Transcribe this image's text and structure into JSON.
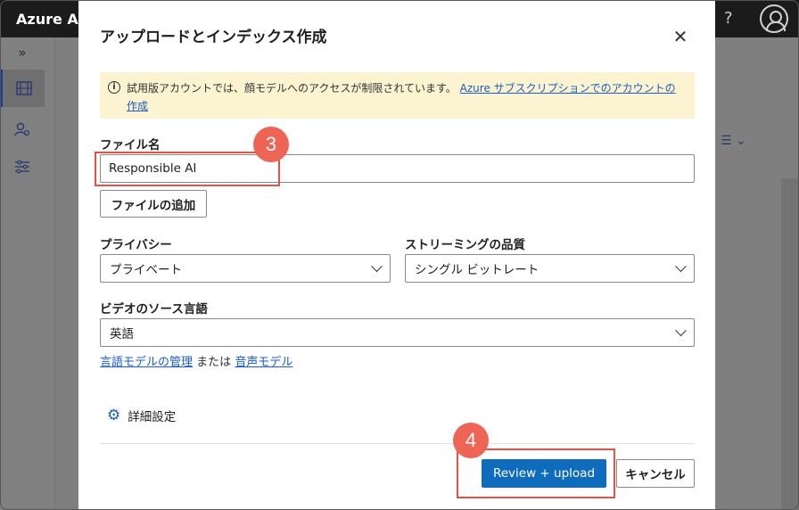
{
  "app": {
    "title": "Azure AI V",
    "help_label": "?",
    "icons": {
      "sidebar_expand": "double-chevron-right-icon",
      "video": "film-icon",
      "people": "people-icon",
      "filter": "sliders-icon",
      "sort": "sort-lines-icon",
      "help": "question-icon",
      "avatar": "user-avatar-icon"
    }
  },
  "dialog": {
    "title": "アップロードとインデックス作成",
    "notice": {
      "text": "試用版アカウントでは、顔モデルへのアクセスが制限されています。",
      "link": "Azure サブスクリプションでのアカウントの作成"
    },
    "file_name": {
      "label": "ファイル名",
      "value": "Responsible AI"
    },
    "add_file_button": "ファイルの追加",
    "privacy": {
      "label": "プライバシー",
      "selected": "プライベート"
    },
    "streaming": {
      "label": "ストリーミングの品質",
      "selected": "シングル ビットレート"
    },
    "source_language": {
      "label": "ビデオのソース言語",
      "selected": "英語"
    },
    "model_links": {
      "language_model": "言語モデルの管理",
      "separator": "または",
      "speech_model": "音声モデル"
    },
    "advanced_settings": "詳細設定",
    "primary_button": "Review + upload",
    "cancel_button": "キャンセル"
  },
  "annotations": {
    "step_file_name": "3",
    "step_upload": "4",
    "highlight_color": "#e0524a"
  },
  "colors": {
    "accent": "#0f6cbd",
    "notice_bg": "#fcf3d0",
    "link": "#1a5ec7"
  }
}
